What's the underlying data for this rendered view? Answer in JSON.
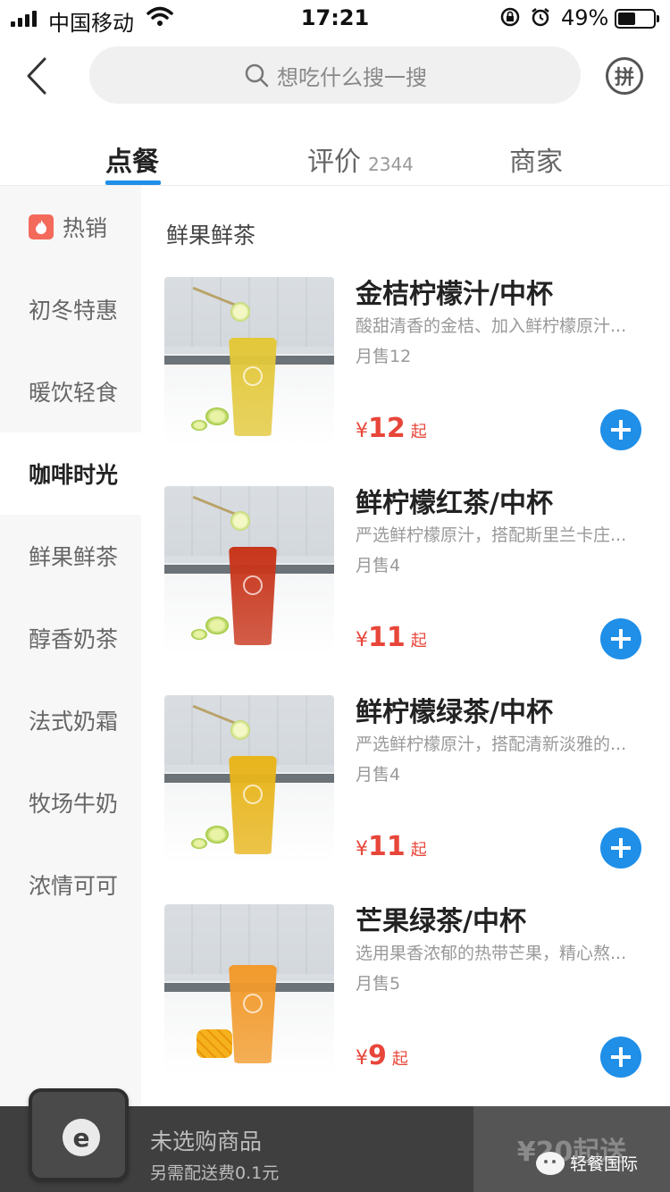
{
  "status_bar": {
    "carrier": "中国移动",
    "time": "17:21",
    "battery": "49%",
    "battery_level": 0.49
  },
  "search": {
    "placeholder": "想吃什么搜一搜"
  },
  "header": {
    "pin_label": "拼"
  },
  "tabs": [
    {
      "label": "点餐",
      "active": true
    },
    {
      "label": "评价",
      "count": "2344"
    },
    {
      "label": "商家"
    }
  ],
  "sidebar": {
    "items": [
      {
        "label": "热销",
        "icon": "flame-icon"
      },
      {
        "label": "初冬特惠"
      },
      {
        "label": "暖饮轻食"
      },
      {
        "label": "咖啡时光",
        "active": true
      },
      {
        "label": "鲜果鲜茶"
      },
      {
        "label": "醇香奶茶"
      },
      {
        "label": "法式奶霜"
      },
      {
        "label": "牧场牛奶"
      },
      {
        "label": "浓情可可"
      }
    ]
  },
  "section": {
    "title": "鲜果鲜茶"
  },
  "products": [
    {
      "name": "金桔柠檬汁/中杯",
      "desc": "酸甜清香的金桔、加入鲜柠檬原汁...",
      "sales": "月售12",
      "currency": "¥",
      "price": "12",
      "price_suffix": "起",
      "drink_color": "#e3c83a"
    },
    {
      "name": "鲜柠檬红茶/中杯",
      "desc": "严选鲜柠檬原汁，搭配斯里兰卡庄...",
      "sales": "月售4",
      "currency": "¥",
      "price": "11",
      "price_suffix": "起",
      "drink_color": "#c8361c"
    },
    {
      "name": "鲜柠檬绿茶/中杯",
      "desc": "严选鲜柠檬原汁，搭配清新淡雅的...",
      "sales": "月售4",
      "currency": "¥",
      "price": "11",
      "price_suffix": "起",
      "drink_color": "#e8b51c"
    },
    {
      "name": "芒果绿茶/中杯",
      "desc": "选用果香浓郁的热带芒果，精心熬...",
      "sales": "月售5",
      "currency": "¥",
      "price": "9",
      "price_suffix": "起",
      "drink_color": "#f29a2c"
    }
  ],
  "cart": {
    "icon_letter": "e",
    "status": "未选购商品",
    "delivery_fee": "另需配送费0.1元",
    "checkout": "¥20起送"
  },
  "watermark": {
    "text": "轻餐国际"
  },
  "colors": {
    "accent": "#1f8fe8",
    "price": "#e8463a",
    "hot": "#f36a5b"
  }
}
